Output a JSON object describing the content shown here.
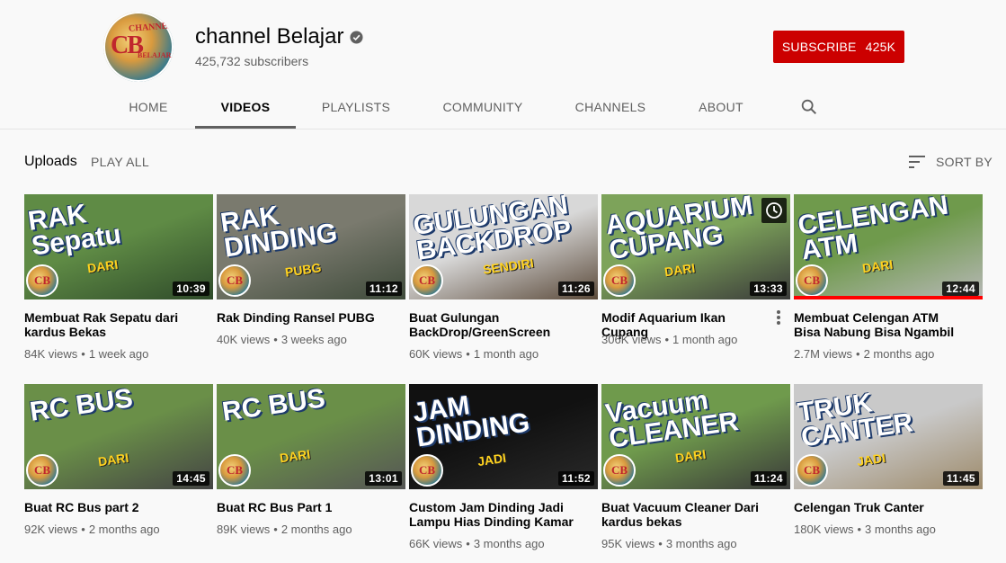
{
  "channel": {
    "name": "channel Belajar",
    "subscribers": "425,732 subscribers",
    "avatar_text": "CB",
    "avatar_ring": "CHANNEL",
    "avatar_ring2": "BELAJAR",
    "verified_icon": "verified-check-icon",
    "subscribe_label": "SUBSCRIBE",
    "subscribe_count": "425K"
  },
  "tabs": [
    "HOME",
    "VIDEOS",
    "PLAYLISTS",
    "COMMUNITY",
    "CHANNELS",
    "ABOUT"
  ],
  "active_tab": "VIDEOS",
  "section": {
    "title": "Uploads",
    "play_all": "PLAY ALL",
    "sort_by": "SORT BY"
  },
  "colors": {
    "subscribe": "#cc0000",
    "progress": "#ff0000"
  },
  "videos": [
    {
      "title": "Membuat Rak Sepatu dari kardus Bekas",
      "views": "84K views",
      "age": "1 week ago",
      "duration": "10:39",
      "thumb_text": "RAK\nSepatu",
      "thumb_sub": "DARI",
      "thumb_colors": [
        "#5f8b45",
        "#2f4b2a"
      ]
    },
    {
      "title": "Rak Dinding Ransel PUBG",
      "views": "40K views",
      "age": "3 weeks ago",
      "duration": "11:12",
      "thumb_text": "RAK\nDINDING",
      "thumb_sub": "PUBG",
      "thumb_colors": [
        "#7a7a6e",
        "#3e4a3a"
      ]
    },
    {
      "title": "Buat Gulungan BackDrop/GreenScreen",
      "views": "60K views",
      "age": "1 month ago",
      "duration": "11:26",
      "thumb_text": "GULUNGAN\nBACKDROP",
      "thumb_sub": "SENDIRI",
      "thumb_colors": [
        "#d8d8d8",
        "#5b4a3a"
      ]
    },
    {
      "title": "Modif Aquarium Ikan Cupang",
      "views": "306K views",
      "age": "1 month ago",
      "duration": "13:33",
      "thumb_text": "AQUARIUM\nCUPANG",
      "thumb_sub": "DARI",
      "thumb_colors": [
        "#7da35a",
        "#3a3a3a"
      ],
      "watch_later": true,
      "menu": true
    },
    {
      "title": "Membuat Celengan ATM Bisa Nabung Bisa Ngambil",
      "views": "2.7M views",
      "age": "2 months ago",
      "duration": "12:44",
      "thumb_text": "CELENGAN\nATM",
      "thumb_sub": "DARI",
      "thumb_colors": [
        "#6f9a4c",
        "#b8b8b8"
      ],
      "progress": 1.0
    },
    {
      "title": "Buat RC Bus part 2",
      "views": "92K views",
      "age": "2 months ago",
      "duration": "14:45",
      "thumb_text": "RC BUS",
      "thumb_sub": "DARI",
      "thumb_colors": [
        "#6a8f48",
        "#444444"
      ]
    },
    {
      "title": "Buat RC Bus Part 1",
      "views": "89K views",
      "age": "2 months ago",
      "duration": "13:01",
      "thumb_text": "RC BUS",
      "thumb_sub": "DARI",
      "thumb_colors": [
        "#6a8f48",
        "#555555"
      ]
    },
    {
      "title": "Custom Jam Dinding Jadi Lampu Hias Dinding Kamar",
      "views": "66K views",
      "age": "3 months ago",
      "duration": "11:52",
      "thumb_text": "JAM\nDINDING",
      "thumb_sub": "JADI",
      "thumb_colors": [
        "#111111",
        "#2a2a2a"
      ]
    },
    {
      "title": "Buat Vacuum Cleaner Dari kardus bekas",
      "views": "95K views",
      "age": "3 months ago",
      "duration": "11:24",
      "thumb_text": "Vacuum\nCLEANER",
      "thumb_sub": "DARI",
      "thumb_colors": [
        "#6f9a4c",
        "#3a3a3a"
      ]
    },
    {
      "title": "Celengan Truk Canter",
      "views": "180K views",
      "age": "3 months ago",
      "duration": "11:45",
      "thumb_text": "TRUK\nCANTER",
      "thumb_sub": "JADI",
      "thumb_colors": [
        "#c9c9c9",
        "#9d8a6a"
      ]
    }
  ]
}
